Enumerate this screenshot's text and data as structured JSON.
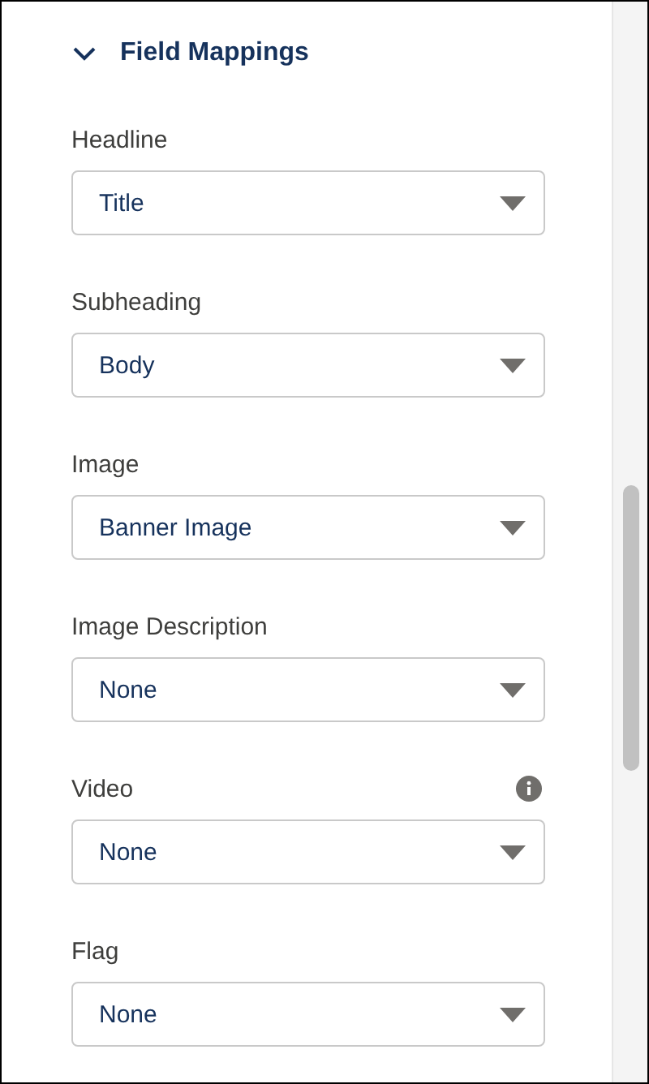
{
  "section": {
    "title": "Field Mappings",
    "expanded": true
  },
  "fields": [
    {
      "label": "Headline",
      "value": "Title",
      "info": false
    },
    {
      "label": "Subheading",
      "value": "Body",
      "info": false
    },
    {
      "label": "Image",
      "value": "Banner Image",
      "info": false
    },
    {
      "label": "Image Description",
      "value": "None",
      "info": false
    },
    {
      "label": "Video",
      "value": "None",
      "info": true
    },
    {
      "label": "Flag",
      "value": "None",
      "info": false
    }
  ]
}
